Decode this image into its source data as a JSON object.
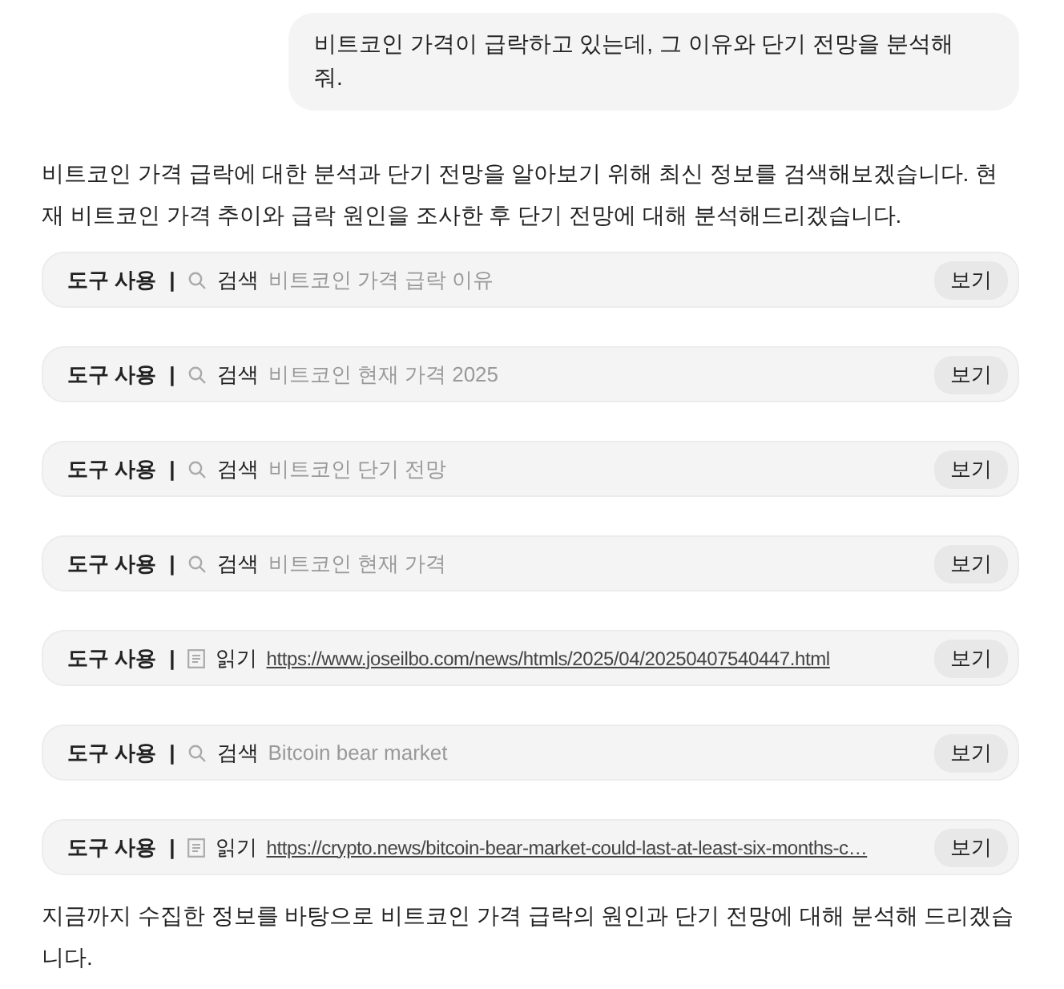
{
  "user_message": "비트코인 가격이 급락하고 있는데, 그 이유와 단기 전망을 분석해 줘.",
  "assistant_intro": "비트코인 가격 급락에 대한 분석과 단기 전망을 알아보기 위해 최신 정보를 검색해보겠습니다. 현재 비트코인 가격 추이와 급락 원인을 조사한 후 단기 전망에 대해 분석해드리겠습니다.",
  "tool_calls": [
    {
      "label": "도구 사용",
      "separator": "|",
      "kind": "search",
      "action": "검색",
      "query": "비트코인 가격 급락 이유",
      "button": "보기"
    },
    {
      "label": "도구 사용",
      "separator": "|",
      "kind": "search",
      "action": "검색",
      "query": "비트코인 현재 가격 2025",
      "button": "보기"
    },
    {
      "label": "도구 사용",
      "separator": "|",
      "kind": "search",
      "action": "검색",
      "query": "비트코인 단기 전망",
      "button": "보기"
    },
    {
      "label": "도구 사용",
      "separator": "|",
      "kind": "search",
      "action": "검색",
      "query": "비트코인 현재 가격",
      "button": "보기"
    },
    {
      "label": "도구 사용",
      "separator": "|",
      "kind": "read",
      "action": "읽기",
      "query": "https://www.joseilbo.com/news/htmls/2025/04/20250407540447.html",
      "button": "보기"
    },
    {
      "label": "도구 사용",
      "separator": "|",
      "kind": "search",
      "action": "검색",
      "query": "Bitcoin bear market",
      "button": "보기"
    },
    {
      "label": "도구 사용",
      "separator": "|",
      "kind": "read",
      "action": "읽기",
      "query": "https://crypto.news/bitcoin-bear-market-could-last-at-least-six-months-c…",
      "button": "보기"
    }
  ],
  "assistant_outro": "지금까지 수집한 정보를 바탕으로 비트코인 가격 급락의 원인과 단기 전망에 대해 분석해 드리겠습니다."
}
